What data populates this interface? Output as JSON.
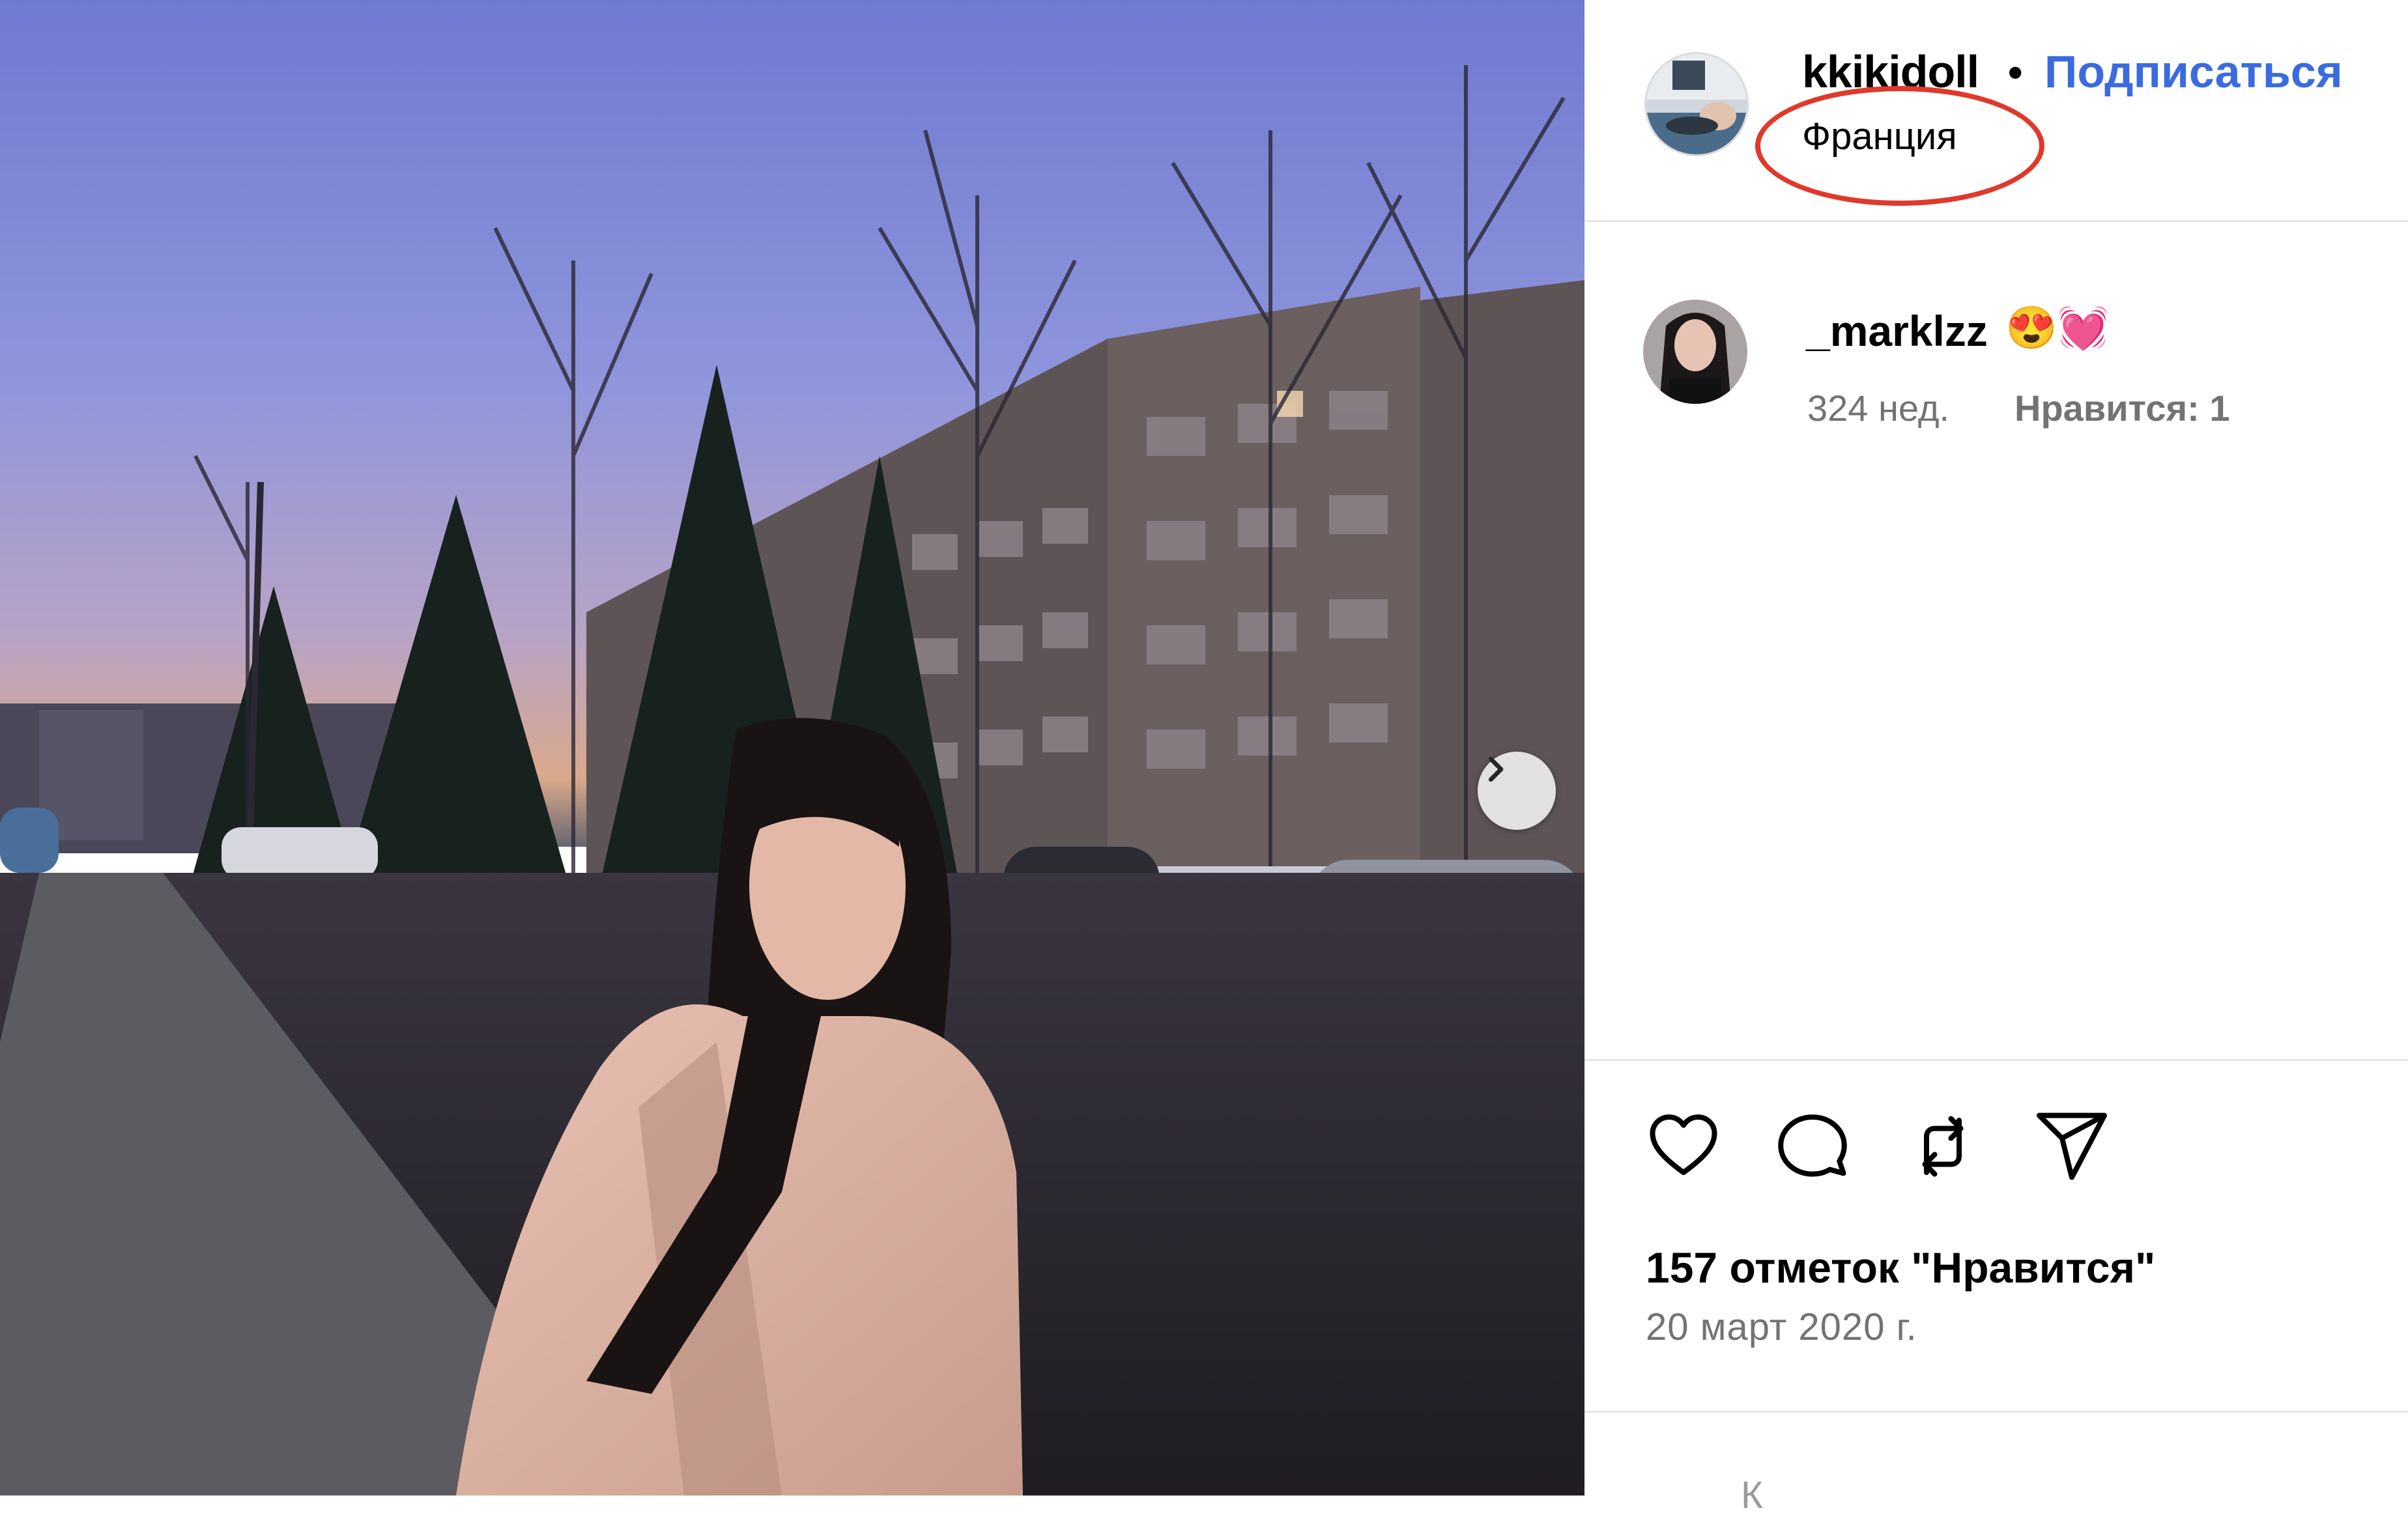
{
  "post": {
    "author": "kkikidoll",
    "separator": "•",
    "follow_label": "Подписаться",
    "location": "Франция"
  },
  "comment": {
    "author": "_marklzz",
    "emoji": "😍💓",
    "time": "324 нед.",
    "likes_label": "Нравится: 1"
  },
  "actions": {
    "icons": [
      "heart-icon",
      "comment-bubble-icon",
      "repost-icon",
      "share-icon"
    ]
  },
  "stats": {
    "likes": "157 отметок \"Нравится\"",
    "date": "20 март 2020 г."
  },
  "footer": {
    "comment_hint": "К"
  },
  "colors": {
    "accent": "#3a6be0",
    "highlight_circle": "#e0392b",
    "muted_text": "#737373",
    "divider": "#e6e6e6"
  }
}
